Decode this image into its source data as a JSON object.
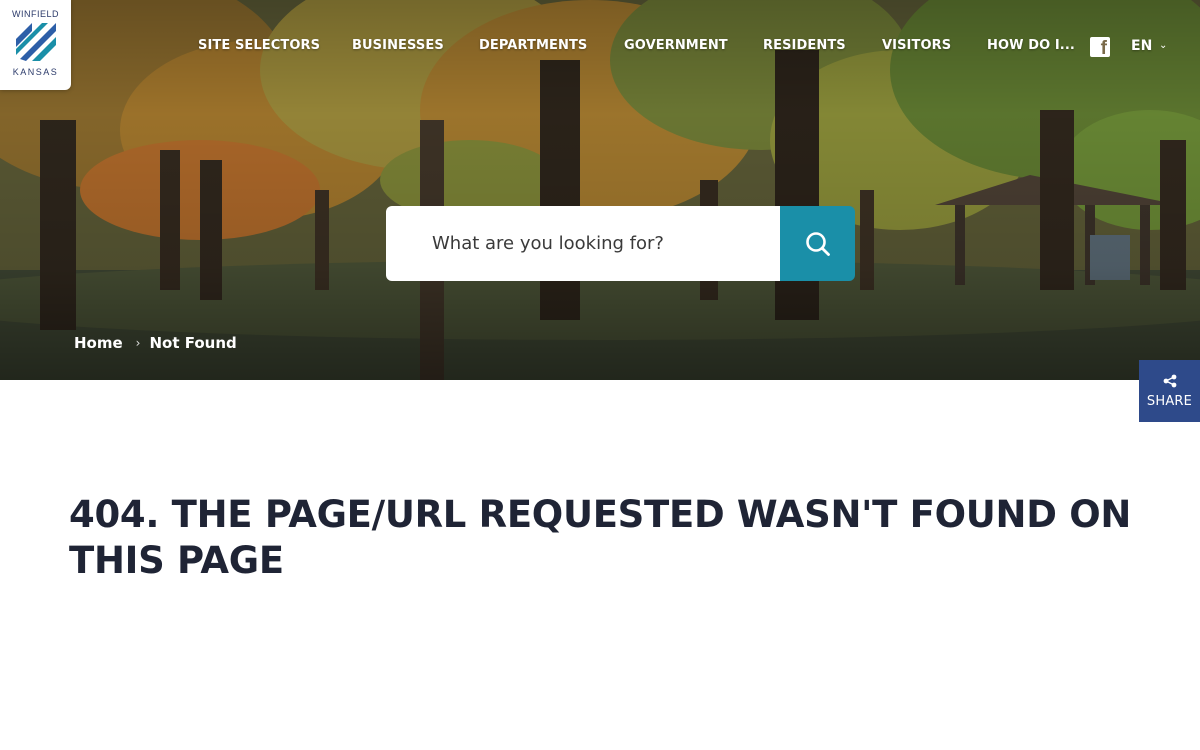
{
  "logo": {
    "top_text": "WINFIELD",
    "bottom_text": "KANSAS"
  },
  "nav": {
    "items": [
      {
        "label": "SITE SELECTORS"
      },
      {
        "label": "BUSINESSES"
      },
      {
        "label": "DEPARTMENTS"
      },
      {
        "label": "GOVERNMENT"
      },
      {
        "label": "RESIDENTS"
      },
      {
        "label": "VISITORS"
      },
      {
        "label": "HOW DO I..."
      }
    ],
    "social_icon": "facebook-icon",
    "language": "EN"
  },
  "search": {
    "placeholder": "What are you looking for?",
    "icon": "search-icon"
  },
  "breadcrumb": {
    "home": "Home",
    "current": "Not Found"
  },
  "share": {
    "label": "SHARE",
    "icon": "share-icon"
  },
  "main": {
    "heading": "404. THE PAGE/URL REQUESTED WASN'T FOUND ON THIS PAGE"
  },
  "colors": {
    "accent": "#1a8fa8",
    "share_bg": "#2e4a8a",
    "heading": "#1f2435"
  }
}
